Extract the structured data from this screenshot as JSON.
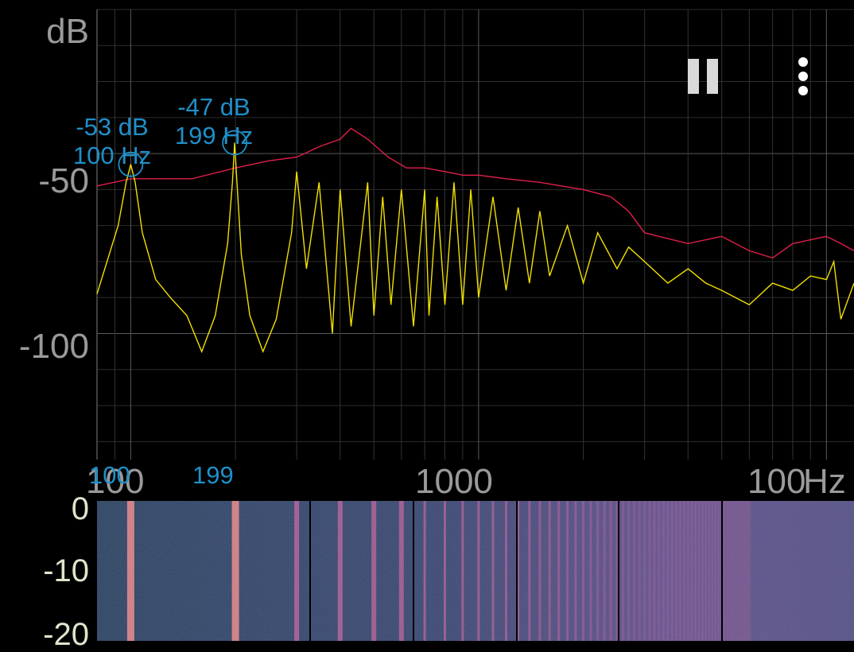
{
  "y_unit": "dB",
  "x_unit": "Hz",
  "controls": {
    "pause_icon": "pause-icon",
    "menu_icon": "more-vert-icon"
  },
  "chart_data": {
    "type": "line",
    "x_scale": "log",
    "xlim": [
      80,
      12000
    ],
    "ylim": [
      -135,
      -10
    ],
    "y_ticks": [
      "dB",
      "-50",
      "-100"
    ],
    "x_ticks": [
      "100",
      "1000",
      "100"
    ],
    "grid": true,
    "series": [
      {
        "color": "#e0204a",
        "x": [
          80,
          100,
          150,
          200,
          250,
          300,
          350,
          400,
          430,
          480,
          550,
          620,
          700,
          800,
          900,
          1000,
          1200,
          1500,
          2000,
          2400,
          2700,
          3000,
          3300,
          4000,
          5000,
          6000,
          7000,
          8000,
          10000,
          11000,
          12000
        ],
        "y": [
          -59,
          -57,
          -57,
          -54,
          -52,
          -51,
          -48,
          -46,
          -43,
          -46,
          -51,
          -54,
          -54,
          -55,
          -56,
          -56,
          -57,
          -58,
          -60,
          -62,
          -66,
          -72,
          -73,
          -75,
          -73,
          -77,
          -79,
          -75,
          -73,
          -75,
          -77
        ]
      },
      {
        "color": "#f2e000",
        "x": [
          80,
          92,
          97,
          100,
          103,
          108,
          118,
          130,
          145,
          160,
          175,
          190,
          196,
          199,
          202,
          208,
          220,
          240,
          262,
          290,
          300,
          320,
          348,
          380,
          400,
          430,
          480,
          500,
          530,
          560,
          600,
          650,
          700,
          720,
          760,
          800,
          850,
          900,
          950,
          1000,
          1100,
          1200,
          1300,
          1400,
          1500,
          1600,
          1800,
          2000,
          2200,
          2500,
          2700,
          3000,
          3500,
          4000,
          4500,
          5000,
          6000,
          7000,
          8000,
          9000,
          10000,
          10500,
          11000,
          12000
        ],
        "y": [
          -89,
          -70,
          -58,
          -53,
          -58,
          -72,
          -85,
          -90,
          -95,
          -105,
          -95,
          -75,
          -58,
          -47,
          -58,
          -78,
          -95,
          -105,
          -96,
          -72,
          -55,
          -82,
          -58,
          -100,
          -60,
          -98,
          -58,
          -95,
          -62,
          -92,
          -60,
          -98,
          -60,
          -95,
          -62,
          -92,
          -58,
          -92,
          -60,
          -90,
          -62,
          -88,
          -65,
          -86,
          -66,
          -84,
          -70,
          -86,
          -72,
          -82,
          -76,
          -80,
          -86,
          -82,
          -86,
          -88,
          -92,
          -86,
          -88,
          -84,
          -85,
          -80,
          -96,
          -86
        ]
      }
    ],
    "peaks": [
      {
        "db": "-53 dB",
        "hz": "100 Hz",
        "x_label": "100",
        "x": 100,
        "y": -53
      },
      {
        "db": "-47 dB",
        "hz": "199 Hz",
        "x_label": "199",
        "x": 199,
        "y": -47
      }
    ],
    "waterfall_ticks": [
      "0",
      "-10",
      "-20"
    ]
  }
}
